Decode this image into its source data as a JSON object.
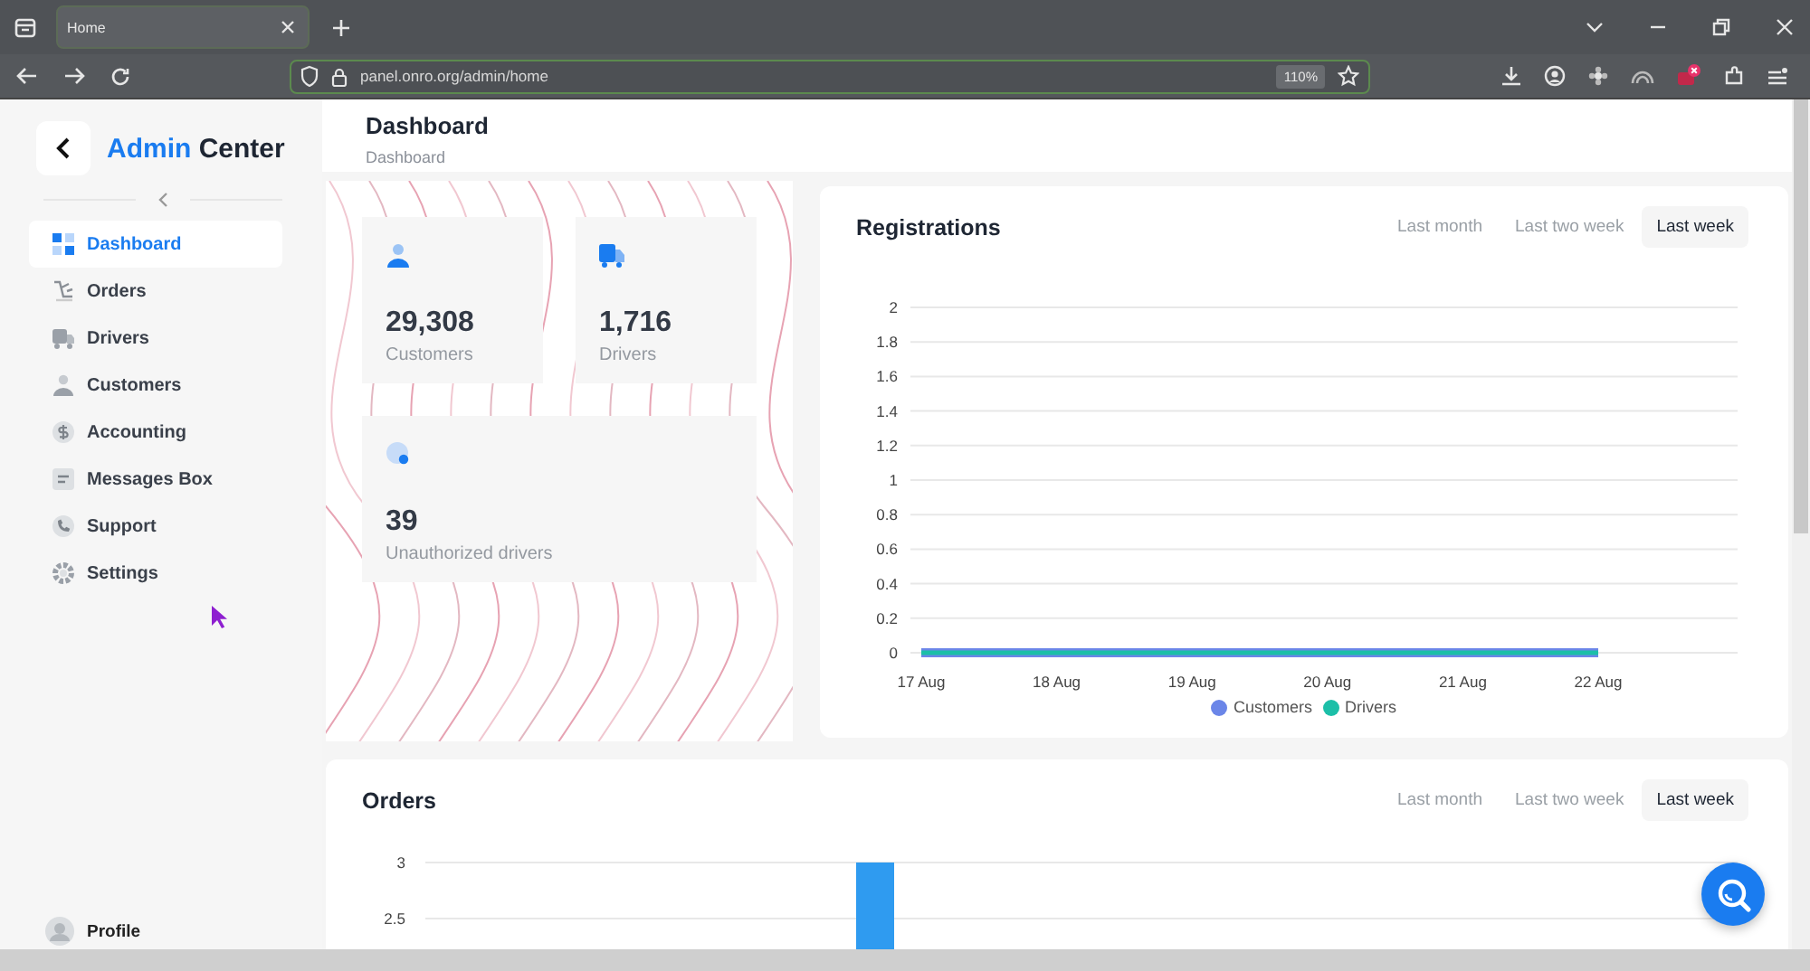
{
  "browser": {
    "tabs": [
      {
        "title": "Home"
      }
    ],
    "url": "panel.onro.org/admin/home",
    "zoom": "110%"
  },
  "sidebar": {
    "title": "Admin Center",
    "items": [
      {
        "label": "Dashboard",
        "kind": "dashboard",
        "selected": true
      },
      {
        "label": "Orders",
        "kind": "orders",
        "selected": false
      },
      {
        "label": "Drivers",
        "kind": "drivers",
        "selected": false
      },
      {
        "label": "Customers",
        "kind": "customers",
        "selected": false
      },
      {
        "label": "Accounting",
        "kind": "accounting",
        "selected": false
      },
      {
        "label": "Messages Box",
        "kind": "messages",
        "selected": false
      },
      {
        "label": "Support",
        "kind": "support",
        "selected": false
      },
      {
        "label": "Settings",
        "kind": "settings",
        "selected": false
      }
    ],
    "profile": "Profile"
  },
  "header": {
    "title": "Dashboard",
    "breadcrumb": "Dashboard"
  },
  "stats": [
    {
      "kind": "customers",
      "value": "29,308",
      "label": "Customers"
    },
    {
      "kind": "drivers",
      "value": "1,716",
      "label": "Drivers"
    },
    {
      "kind": "unauthorized",
      "value": "39",
      "label": "Unauthorized drivers"
    }
  ],
  "registrations": {
    "title": "Registrations",
    "ranges": [
      {
        "label": "Last month",
        "selected": false
      },
      {
        "label": "Last two week",
        "selected": false
      },
      {
        "label": "Last week",
        "selected": true
      }
    ],
    "chart_data": {
      "type": "line",
      "categories": [
        "17 Aug",
        "18 Aug",
        "19 Aug",
        "20 Aug",
        "21 Aug",
        "22 Aug"
      ],
      "ylim": [
        0,
        2
      ],
      "yticks": [
        0,
        0.2,
        0.4,
        0.6,
        0.8,
        1,
        1.2,
        1.4,
        1.6,
        1.8,
        2
      ],
      "grid": true,
      "series": [
        {
          "name": "Customers",
          "color": "#6b86e8",
          "values": [
            0,
            0,
            0,
            0,
            0,
            0
          ]
        },
        {
          "name": "Drivers",
          "color": "#1cbfa8",
          "values": [
            0,
            0,
            0,
            0,
            0,
            0
          ]
        }
      ]
    }
  },
  "orders": {
    "title": "Orders",
    "ranges": [
      {
        "label": "Last month",
        "selected": false
      },
      {
        "label": "Last two week",
        "selected": false
      },
      {
        "label": "Last week",
        "selected": true
      }
    ],
    "y_labels": [
      "3",
      "2.5"
    ]
  }
}
